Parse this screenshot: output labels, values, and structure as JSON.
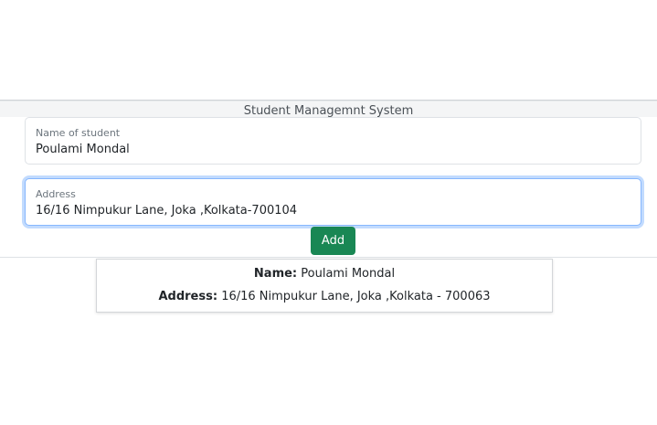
{
  "header": {
    "title": "Student Managemnt System"
  },
  "form": {
    "name_field": {
      "label": "Name of student",
      "value": "Poulami Mondal"
    },
    "address_field": {
      "label": "Address",
      "value": "16/16 Nimpukur Lane, Joka ,Kolkata-700104"
    },
    "add_label": "Add"
  },
  "students": [
    {
      "name_label": "Name:",
      "name": "Poulami Mondal",
      "address_label": "Address:",
      "address": "16/16 Nimpukur Lane, Joka ,Kolkata - 700063"
    }
  ],
  "colors": {
    "add_button": "#198754",
    "focus_border": "#86b7fe"
  }
}
